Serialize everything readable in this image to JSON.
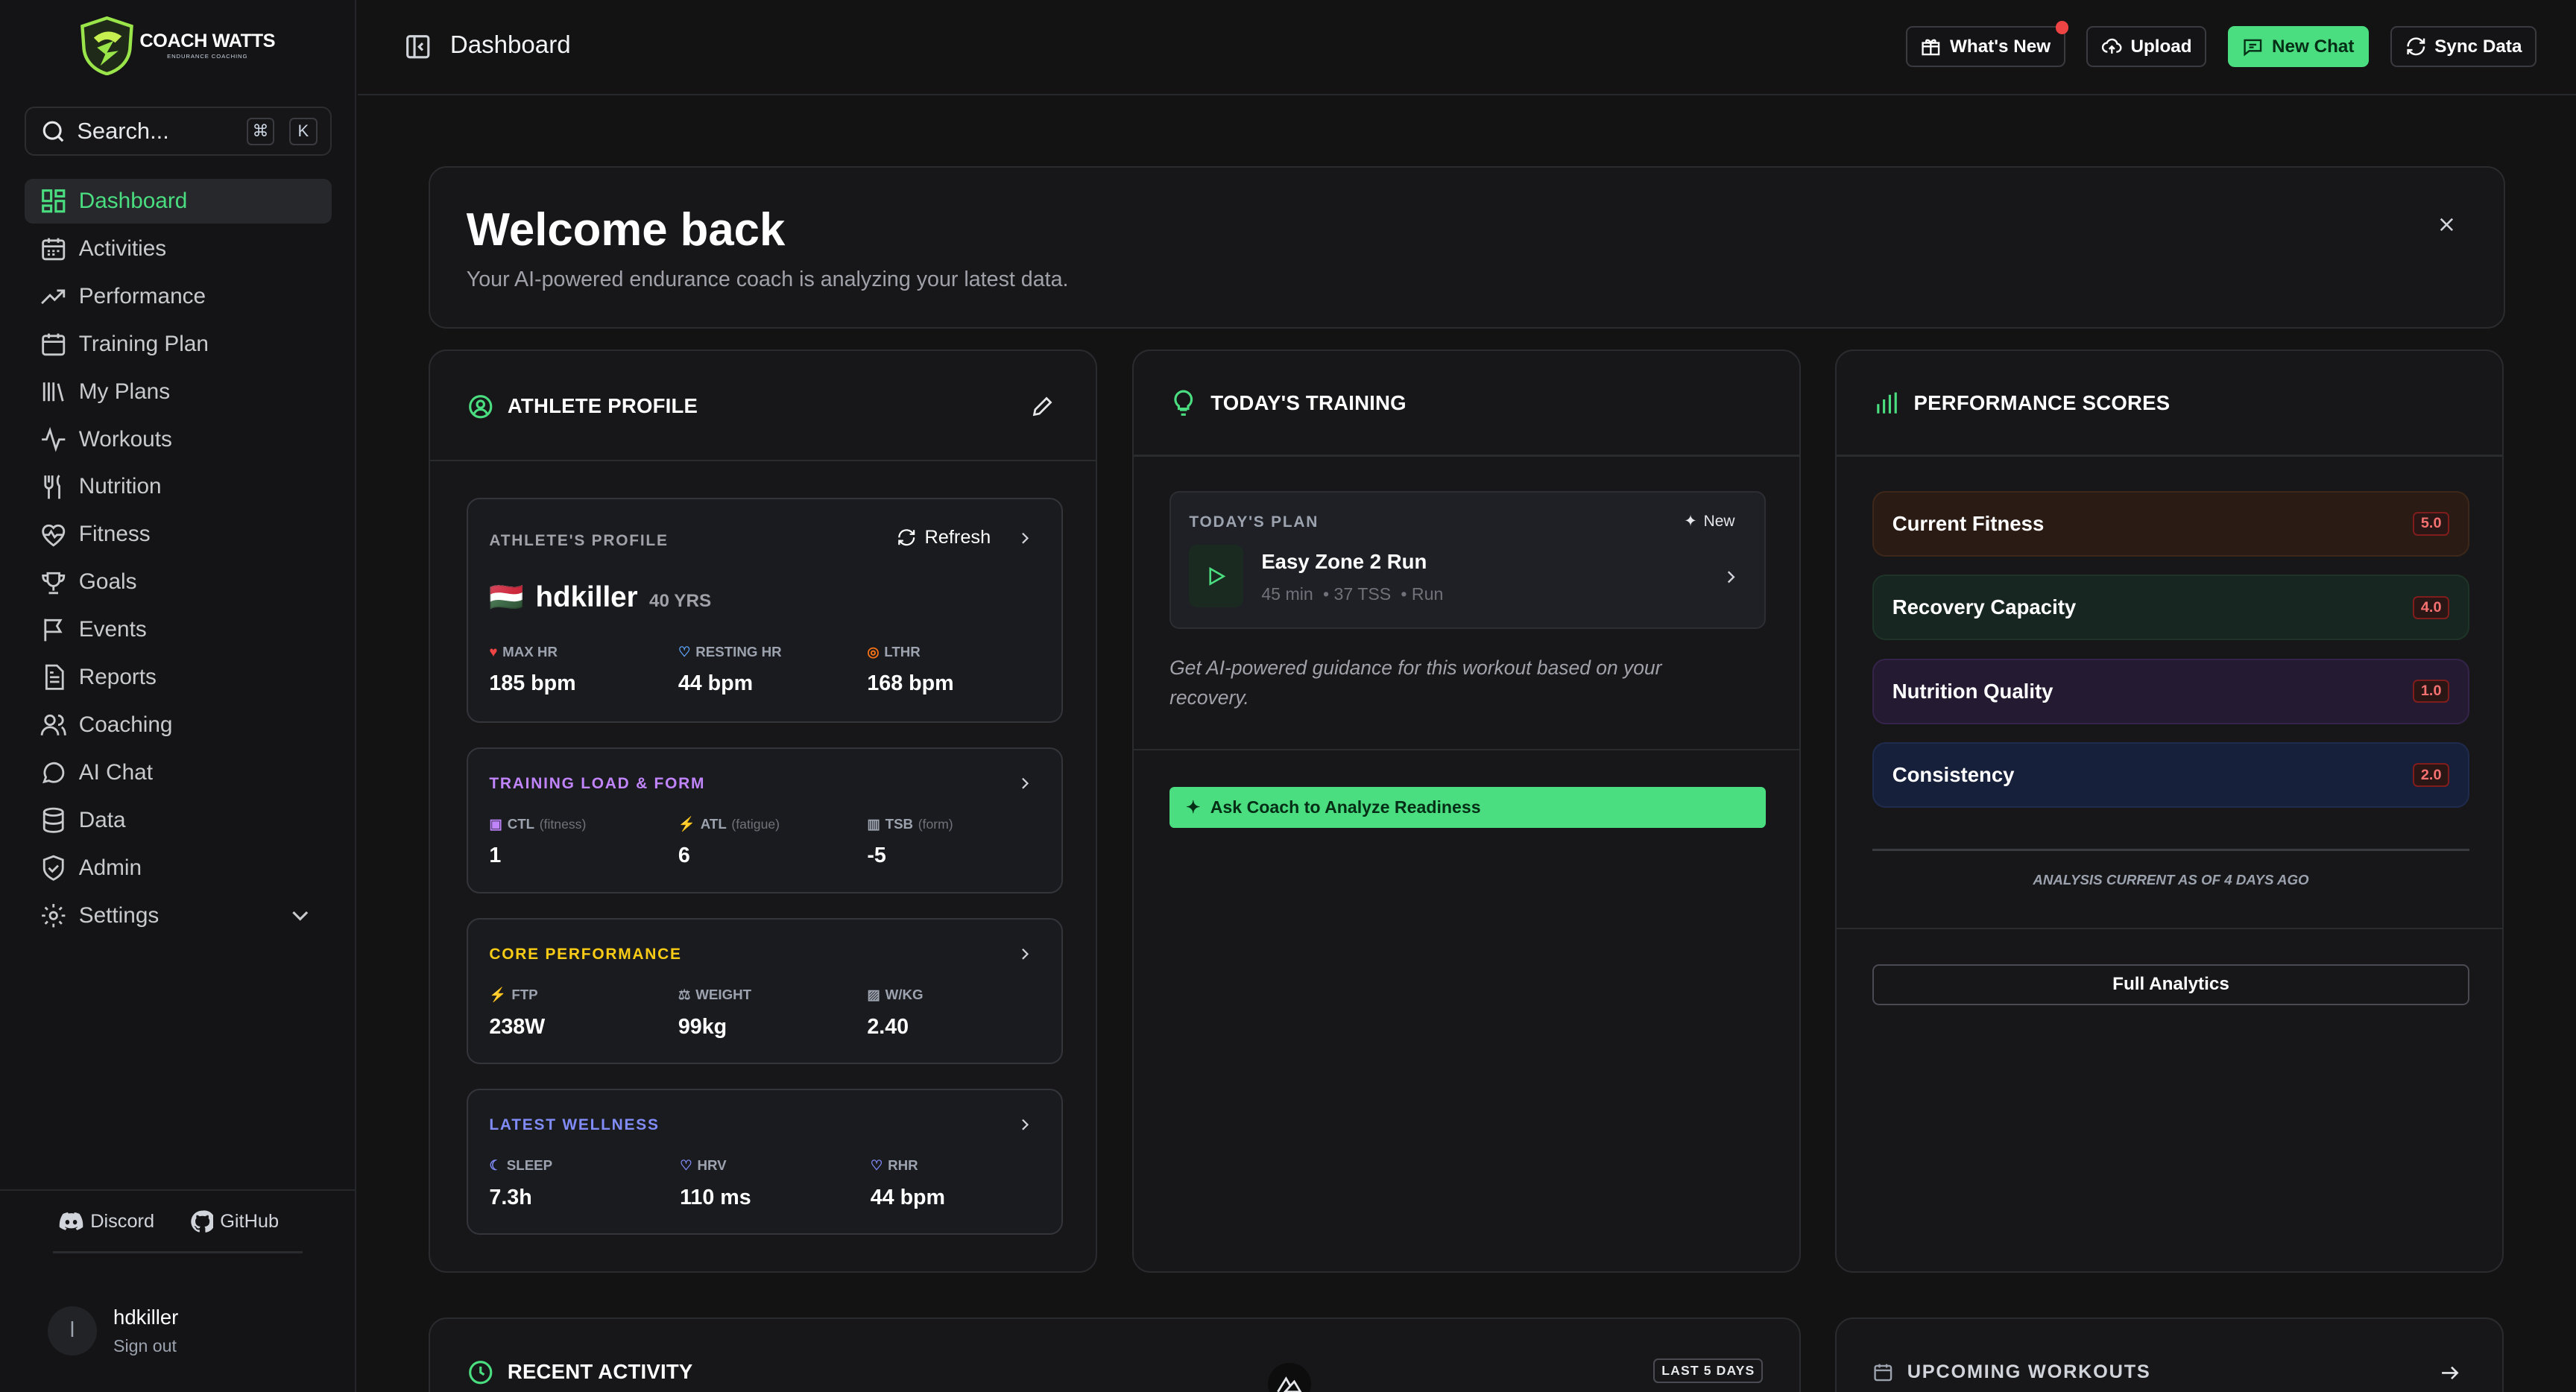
{
  "app": {
    "brand_line1": "COACH WATTS",
    "brand_line2": "ENDURANCE COACHING"
  },
  "search": {
    "placeholder": "Search...",
    "kbd1": "⌘",
    "kbd2": "K"
  },
  "nav": [
    "Dashboard",
    "Activities",
    "Performance",
    "Training Plan",
    "My Plans",
    "Workouts",
    "Nutrition",
    "Fitness",
    "Goals",
    "Events",
    "Reports",
    "Coaching",
    "AI Chat",
    "Data",
    "Admin",
    "Settings"
  ],
  "footer": {
    "discord": "Discord",
    "github": "GitHub",
    "user_initial": "l",
    "user_name": "hdkiller",
    "signout": "Sign out"
  },
  "header": {
    "title": "Dashboard",
    "whats_new": "What's New",
    "upload": "Upload",
    "new_chat": "New Chat",
    "sync": "Sync Data"
  },
  "welcome": {
    "title": "Welcome back",
    "subtitle": "Your AI-powered endurance coach is analyzing your latest data."
  },
  "athlete": {
    "title": "ATHLETE PROFILE",
    "profile_label": "ATHLETE'S PROFILE",
    "refresh": "Refresh",
    "flag": "🇭🇺",
    "name": "hdkiller",
    "age": "40 YRS",
    "stats": [
      {
        "label": "MAX HR",
        "value": "185 bpm"
      },
      {
        "label": "RESTING HR",
        "value": "44 bpm"
      },
      {
        "label": "LTHR",
        "value": "168 bpm"
      }
    ],
    "load": {
      "label": "TRAINING LOAD & FORM",
      "items": [
        {
          "label": "CTL",
          "hint": "(fitness)",
          "value": "1"
        },
        {
          "label": "ATL",
          "hint": "(fatigue)",
          "value": "6"
        },
        {
          "label": "TSB",
          "hint": "(form)",
          "value": "-5"
        }
      ]
    },
    "core": {
      "label": "CORE PERFORMANCE",
      "items": [
        {
          "label": "FTP",
          "value": "238W"
        },
        {
          "label": "WEIGHT",
          "value": "99kg"
        },
        {
          "label": "W/KG",
          "value": "2.40"
        }
      ]
    },
    "wellness": {
      "label": "LATEST WELLNESS",
      "items": [
        {
          "label": "SLEEP",
          "value": "7.3h"
        },
        {
          "label": "HRV",
          "value": "110 ms"
        },
        {
          "label": "RHR",
          "value": "44 bpm"
        }
      ]
    }
  },
  "training": {
    "title": "TODAY'S TRAINING",
    "plan_label": "TODAY'S PLAN",
    "new_label": "New",
    "workout": "Easy Zone 2 Run",
    "duration": "45 min",
    "tss": "• 37 TSS",
    "type": "• Run",
    "guidance": "Get AI-powered guidance for this workout based on your recovery.",
    "ask_button": "Ask Coach to Analyze Readiness"
  },
  "scores": {
    "title": "PERFORMANCE SCORES",
    "items": [
      {
        "label": "Current Fitness",
        "value": "5.0"
      },
      {
        "label": "Recovery Capacity",
        "value": "4.0"
      },
      {
        "label": "Nutrition Quality",
        "value": "1.0"
      },
      {
        "label": "Consistency",
        "value": "2.0"
      }
    ],
    "note": "ANALYSIS CURRENT AS OF 4 DAYS AGO",
    "full_button": "Full Analytics"
  },
  "recent": {
    "title": "RECENT ACTIVITY",
    "badge": "LAST 5 DAYS"
  },
  "upcoming": {
    "title": "UPCOMING WORKOUTS"
  },
  "colors": {
    "accent": "#4ade80",
    "fitness": "#f97316",
    "recovery": "#22c55e",
    "nutrition": "#a855f7",
    "consistency": "#3b82f6",
    "badge_red": "#f87171"
  }
}
